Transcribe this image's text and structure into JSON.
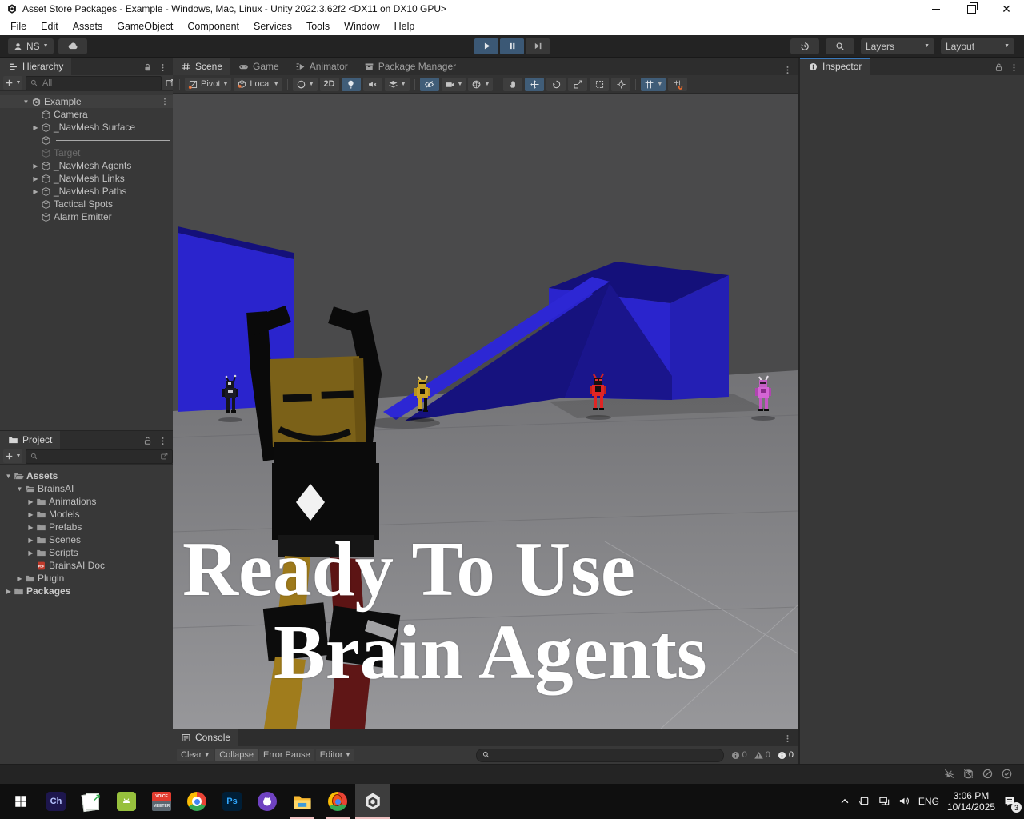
{
  "window": {
    "title": "Asset Store Packages - Example - Windows, Mac, Linux - Unity 2022.3.62f2 <DX11 on DX10 GPU>"
  },
  "menu": [
    "File",
    "Edit",
    "Assets",
    "GameObject",
    "Component",
    "Services",
    "Tools",
    "Window",
    "Help"
  ],
  "toolbar": {
    "account": "NS",
    "layers": "Layers",
    "layout": "Layout"
  },
  "panels": {
    "hierarchy": {
      "tab": "Hierarchy",
      "search_placeholder": "All",
      "items": [
        {
          "label": "Example",
          "kind": "scene",
          "depth": 0,
          "expanded": true
        },
        {
          "label": "Camera",
          "kind": "object",
          "depth": 1
        },
        {
          "label": "_NavMesh Surface",
          "kind": "object",
          "depth": 1,
          "collapsible": true
        },
        {
          "label": "",
          "kind": "separator",
          "depth": 1
        },
        {
          "label": "Target",
          "kind": "object",
          "depth": 1,
          "disabled": true
        },
        {
          "label": "_NavMesh Agents",
          "kind": "object",
          "depth": 1,
          "collapsible": true
        },
        {
          "label": "_NavMesh Links",
          "kind": "object",
          "depth": 1,
          "collapsible": true
        },
        {
          "label": "_NavMesh Paths",
          "kind": "object",
          "depth": 1,
          "collapsible": true
        },
        {
          "label": "Tactical Spots",
          "kind": "object",
          "depth": 1
        },
        {
          "label": "Alarm Emitter",
          "kind": "object",
          "depth": 1
        }
      ]
    },
    "project": {
      "tab": "Project",
      "search_placeholder": "",
      "items": [
        {
          "label": "Assets",
          "depth": 0,
          "icon": "folder-open",
          "expanded": true,
          "bold": true
        },
        {
          "label": "BrainsAI",
          "depth": 1,
          "icon": "folder-open",
          "expanded": true
        },
        {
          "label": "Animations",
          "depth": 2,
          "icon": "folder",
          "collapsible": true
        },
        {
          "label": "Models",
          "depth": 2,
          "icon": "folder",
          "collapsible": true
        },
        {
          "label": "Prefabs",
          "depth": 2,
          "icon": "folder",
          "collapsible": true
        },
        {
          "label": "Scenes",
          "depth": 2,
          "icon": "folder",
          "collapsible": true
        },
        {
          "label": "Scripts",
          "depth": 2,
          "icon": "folder",
          "collapsible": true
        },
        {
          "label": "BrainsAI Doc",
          "depth": 2,
          "icon": "pdf"
        },
        {
          "label": "Plugin",
          "depth": 1,
          "icon": "folder",
          "collapsible": true
        },
        {
          "label": "Packages",
          "depth": 0,
          "icon": "folder",
          "collapsible": true,
          "bold": true
        }
      ]
    },
    "inspector": {
      "tab": "Inspector"
    },
    "console": {
      "tab": "Console",
      "clear": "Clear",
      "collapse": "Collapse",
      "error_pause": "Error Pause",
      "editor": "Editor",
      "info_count": "0",
      "warning_count": "0",
      "error_count": "0"
    }
  },
  "scene": {
    "tabs": [
      {
        "label": "Scene",
        "icon": "hash",
        "active": true
      },
      {
        "label": "Game",
        "icon": "gamepad"
      },
      {
        "label": "Animator",
        "icon": "animator"
      },
      {
        "label": "Package Manager",
        "icon": "package"
      }
    ],
    "toolbar": {
      "pivot": "Pivot",
      "local": "Local",
      "two_d": "2D"
    },
    "overlay": {
      "line1": "Ready To Use",
      "line2": "Brain Agents"
    }
  },
  "taskbar": {
    "apps": [
      {
        "name": "start"
      },
      {
        "name": "character-animator",
        "label": "Ch"
      },
      {
        "name": "docs-app"
      },
      {
        "name": "android-app"
      },
      {
        "name": "voicemeeter",
        "label": "VOICE",
        "label2": "MEETER"
      },
      {
        "name": "chrome"
      },
      {
        "name": "photoshop",
        "label": "Ps"
      },
      {
        "name": "github"
      },
      {
        "name": "file-explorer",
        "running": true
      },
      {
        "name": "chrome-profile",
        "running": true
      },
      {
        "name": "unity",
        "running": true,
        "active": true
      }
    ],
    "tray": {
      "language": "ENG",
      "time": "3:06 PM",
      "date": "10/14/2025",
      "notification_count": "3"
    }
  },
  "colors": {
    "selection_blue": "#405d78",
    "inspector_focus_blue": "#3a79bb",
    "scene_blue": "#2a24cd",
    "scene_blue_dark": "#16127e",
    "scene_background": "#4a4a4b",
    "floor_gray": "#8e8e90",
    "taskbar_underline": "#eec0c0"
  }
}
